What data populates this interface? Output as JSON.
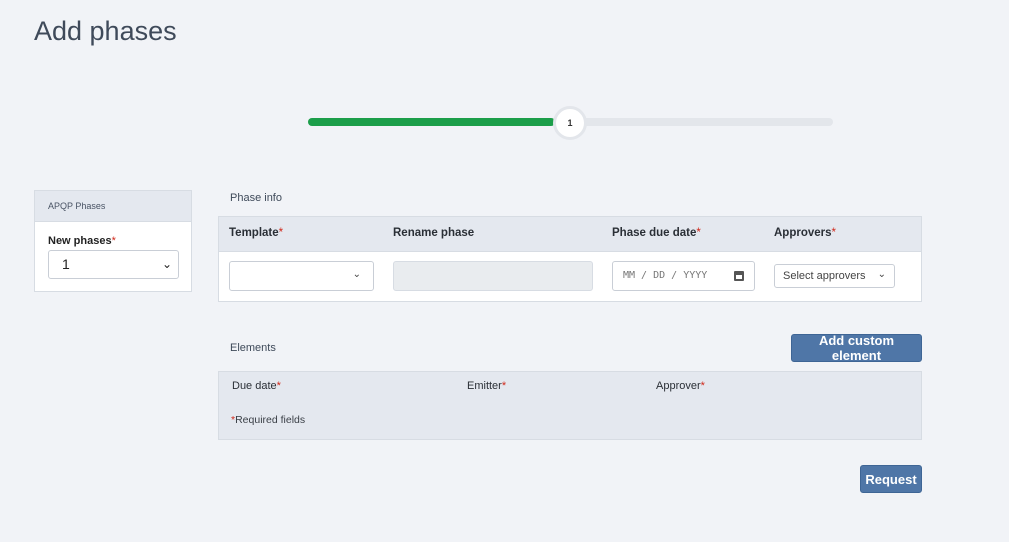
{
  "page": {
    "title": "Add phases"
  },
  "stepper": {
    "current_step": "1",
    "progress_percent": 47
  },
  "side_panel": {
    "header": "APQP Phases",
    "new_phases_label": "New phases",
    "new_phases_value": "1",
    "required_mark": "*"
  },
  "phase_info": {
    "section_title": "Phase info",
    "columns": {
      "template": "Template",
      "rename": "Rename phase",
      "due_date": "Phase due date",
      "approvers": "Approvers"
    },
    "required_mark": "*",
    "template_value": "",
    "rename_value": "",
    "due_date_placeholder": "MM / DD / YYYY",
    "approvers_placeholder": "Select approvers"
  },
  "elements": {
    "section_title": "Elements",
    "add_button": "Add custom element",
    "columns": {
      "due_date": "Due date",
      "emitter": "Emitter",
      "approver": "Approver"
    },
    "required_mark": "*",
    "required_note": "Required fields"
  },
  "actions": {
    "request_button": "Request"
  },
  "colors": {
    "progress": "#1c9e4a",
    "button": "#4f76a7",
    "required": "#d0281a"
  }
}
